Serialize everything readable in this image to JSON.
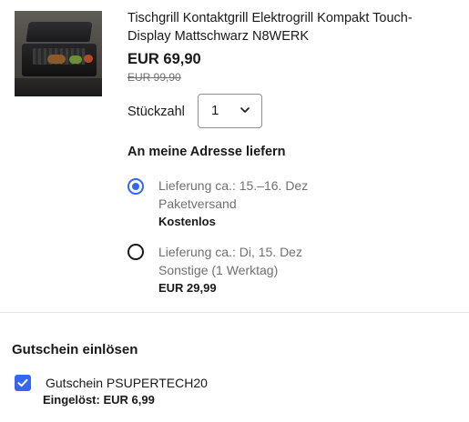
{
  "product": {
    "title": "Tischgrill Kontaktgrill Elektrogrill Kompakt Touch-Display Mattschwarz N8WERK",
    "price_current": "EUR 69,90",
    "price_old": "EUR 99,90",
    "image_icon": "contact-grill-photo"
  },
  "quantity": {
    "label": "Stückzahl",
    "value": "1",
    "chevron_icon": "chevron-down-icon"
  },
  "shipping": {
    "heading": "An meine Adresse liefern",
    "options": [
      {
        "delivery": "Lieferung ca.: 15.–16. Dez",
        "method": "Paketversand",
        "cost": "Kostenlos",
        "selected": true
      },
      {
        "delivery": "Lieferung ca.: Di, 15. Dez",
        "method": "Sonstige (1 Werktag)",
        "cost": "EUR 29,99",
        "selected": false
      }
    ]
  },
  "voucher": {
    "heading": "Gutschein einlösen",
    "name": "Gutschein PSUPERTECH20",
    "redeemed": "Eingelöst: EUR 6,99",
    "checked": true
  },
  "colors": {
    "accent": "#3665f3",
    "text": "#191919",
    "muted": "#707070",
    "divider": "#e5e5e5"
  }
}
